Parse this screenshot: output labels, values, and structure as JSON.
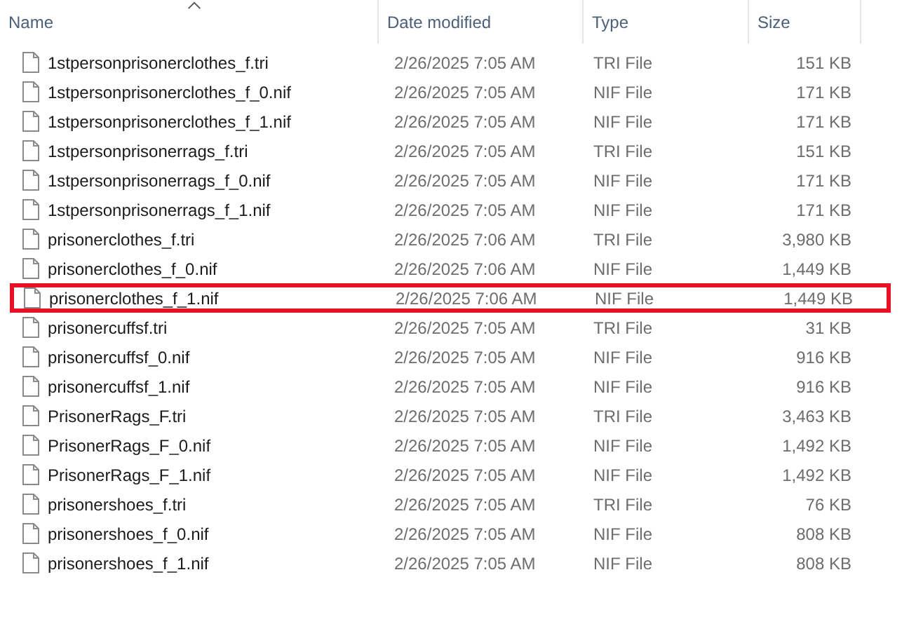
{
  "columns": [
    {
      "label": "Name",
      "sorted": true
    },
    {
      "label": "Date modified",
      "sorted": false
    },
    {
      "label": "Type",
      "sorted": false
    },
    {
      "label": "Size",
      "sorted": false
    }
  ],
  "files": [
    {
      "name": "1stpersonprisonerclothes_f.tri",
      "date": "2/26/2025 7:05 AM",
      "type": "TRI File",
      "size": "151 KB",
      "highlighted": false
    },
    {
      "name": "1stpersonprisonerclothes_f_0.nif",
      "date": "2/26/2025 7:05 AM",
      "type": "NIF File",
      "size": "171 KB",
      "highlighted": false
    },
    {
      "name": "1stpersonprisonerclothes_f_1.nif",
      "date": "2/26/2025 7:05 AM",
      "type": "NIF File",
      "size": "171 KB",
      "highlighted": false
    },
    {
      "name": "1stpersonprisonerrags_f.tri",
      "date": "2/26/2025 7:05 AM",
      "type": "TRI File",
      "size": "151 KB",
      "highlighted": false
    },
    {
      "name": "1stpersonprisonerrags_f_0.nif",
      "date": "2/26/2025 7:05 AM",
      "type": "NIF File",
      "size": "171 KB",
      "highlighted": false
    },
    {
      "name": "1stpersonprisonerrags_f_1.nif",
      "date": "2/26/2025 7:05 AM",
      "type": "NIF File",
      "size": "171 KB",
      "highlighted": false
    },
    {
      "name": "prisonerclothes_f.tri",
      "date": "2/26/2025 7:06 AM",
      "type": "TRI File",
      "size": "3,980 KB",
      "highlighted": false
    },
    {
      "name": "prisonerclothes_f_0.nif",
      "date": "2/26/2025 7:06 AM",
      "type": "NIF File",
      "size": "1,449 KB",
      "highlighted": false
    },
    {
      "name": "prisonerclothes_f_1.nif",
      "date": "2/26/2025 7:06 AM",
      "type": "NIF File",
      "size": "1,449 KB",
      "highlighted": true
    },
    {
      "name": "prisonercuffsf.tri",
      "date": "2/26/2025 7:05 AM",
      "type": "TRI File",
      "size": "31 KB",
      "highlighted": false
    },
    {
      "name": "prisonercuffsf_0.nif",
      "date": "2/26/2025 7:05 AM",
      "type": "NIF File",
      "size": "916 KB",
      "highlighted": false
    },
    {
      "name": "prisonercuffsf_1.nif",
      "date": "2/26/2025 7:05 AM",
      "type": "NIF File",
      "size": "916 KB",
      "highlighted": false
    },
    {
      "name": "PrisonerRags_F.tri",
      "date": "2/26/2025 7:05 AM",
      "type": "TRI File",
      "size": "3,463 KB",
      "highlighted": false
    },
    {
      "name": "PrisonerRags_F_0.nif",
      "date": "2/26/2025 7:05 AM",
      "type": "NIF File",
      "size": "1,492 KB",
      "highlighted": false
    },
    {
      "name": "PrisonerRags_F_1.nif",
      "date": "2/26/2025 7:05 AM",
      "type": "NIF File",
      "size": "1,492 KB",
      "highlighted": false
    },
    {
      "name": "prisonershoes_f.tri",
      "date": "2/26/2025 7:05 AM",
      "type": "TRI File",
      "size": "76 KB",
      "highlighted": false
    },
    {
      "name": "prisonershoes_f_0.nif",
      "date": "2/26/2025 7:05 AM",
      "type": "NIF File",
      "size": "808 KB",
      "highlighted": false
    },
    {
      "name": "prisonershoes_f_1.nif",
      "date": "2/26/2025 7:05 AM",
      "type": "NIF File",
      "size": "808 KB",
      "highlighted": false
    }
  ]
}
